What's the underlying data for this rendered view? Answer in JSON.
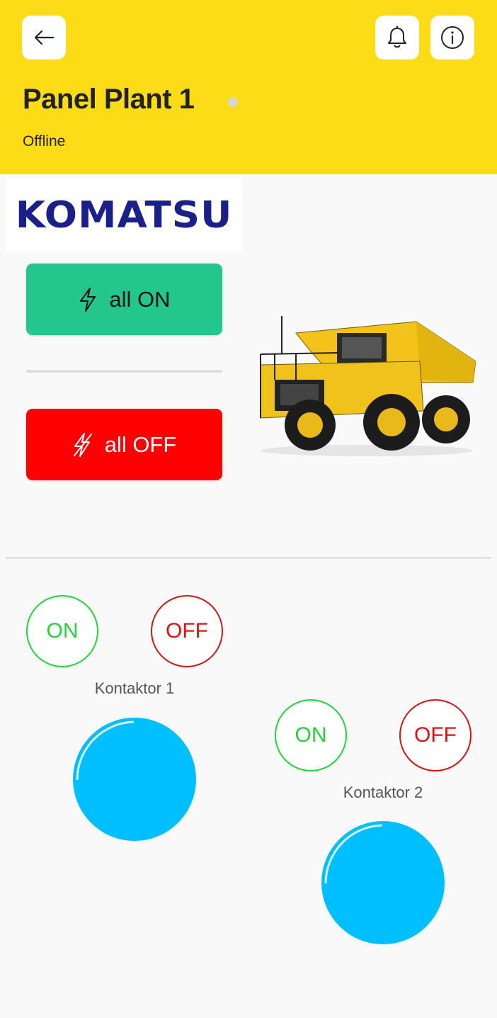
{
  "header": {
    "title": "Panel Plant 1",
    "status": "Offline",
    "back_icon": "arrow-left-icon",
    "bell_icon": "bell-icon",
    "info_icon": "info-icon",
    "background_color": "#fbdc17"
  },
  "logo": {
    "text": "KOMATSU",
    "color": "#1b1f8a"
  },
  "controls": {
    "all_on_label": "all ON",
    "all_off_label": "all OFF",
    "all_on_icon": "lightning-icon",
    "all_off_icon": "lightning-off-icon",
    "on_color": "#23c68c",
    "off_color": "#ff0000"
  },
  "contactors": [
    {
      "label": "Kontaktor 1",
      "on_label": "ON",
      "off_label": "OFF",
      "lamp_color": "#00bfff"
    },
    {
      "label": "Kontaktor 2",
      "on_label": "ON",
      "off_label": "OFF",
      "lamp_color": "#00bfff"
    }
  ]
}
